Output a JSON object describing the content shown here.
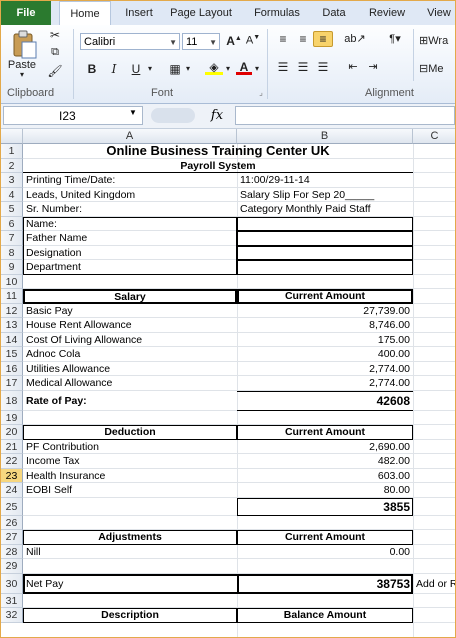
{
  "ribbon": {
    "tabs": [
      "File",
      "Home",
      "Insert",
      "Page Layout",
      "Formulas",
      "Data",
      "Review",
      "View"
    ],
    "clipboard": {
      "paste_label": "Paste",
      "group_label": "Clipboard"
    },
    "font": {
      "name": "Calibri",
      "size": "11",
      "group_label": "Font"
    },
    "alignment": {
      "group_label": "Alignment",
      "wrap_label": "Wra",
      "merge_label": "Me"
    }
  },
  "formula_bar": {
    "name_box": "I23",
    "fx": "fx",
    "value": ""
  },
  "columns": [
    "A",
    "B",
    "C"
  ],
  "rows": [
    {
      "n": "1",
      "a": "Online Business Training Center UK",
      "b": ""
    },
    {
      "n": "2",
      "a": "Payroll System",
      "b": ""
    },
    {
      "n": "3",
      "a": "Printing Time/Date:",
      "b": "11:00/29-11-14"
    },
    {
      "n": "4",
      "a": "Leads, United Kingdom",
      "b": "Salary Slip For Sep 20_____"
    },
    {
      "n": "5",
      "a": "Sr. Number:",
      "b": "Category Monthly Paid Staff"
    },
    {
      "n": "6",
      "a": "Name:",
      "b": ""
    },
    {
      "n": "7",
      "a": "Father Name",
      "b": ""
    },
    {
      "n": "8",
      "a": "Designation",
      "b": ""
    },
    {
      "n": "9",
      "a": "Department",
      "b": ""
    },
    {
      "n": "10",
      "a": "",
      "b": ""
    },
    {
      "n": "11",
      "a": "Salary",
      "b": "Current Amount"
    },
    {
      "n": "12",
      "a": "Basic Pay",
      "b": "27,739.00"
    },
    {
      "n": "13",
      "a": "House Rent Allowance",
      "b": "8,746.00"
    },
    {
      "n": "14",
      "a": "Cost Of Living Allowance",
      "b": "175.00"
    },
    {
      "n": "15",
      "a": "Adnoc Cola",
      "b": "400.00"
    },
    {
      "n": "16",
      "a": "Utilities Allowance",
      "b": "2,774.00"
    },
    {
      "n": "17",
      "a": "Medical Allowance",
      "b": "2,774.00"
    },
    {
      "n": "18",
      "a": "Rate of Pay:",
      "b": "42608"
    },
    {
      "n": "19",
      "a": "",
      "b": ""
    },
    {
      "n": "20",
      "a": "Deduction",
      "b": "Current Amount"
    },
    {
      "n": "21",
      "a": "PF Contribution",
      "b": "2,690.00"
    },
    {
      "n": "22",
      "a": "Income Tax",
      "b": "482.00"
    },
    {
      "n": "23",
      "a": "Health Insurance",
      "b": "603.00"
    },
    {
      "n": "24",
      "a": "EOBI Self",
      "b": "80.00"
    },
    {
      "n": "25",
      "a": "",
      "b": "3855"
    },
    {
      "n": "26",
      "a": "",
      "b": ""
    },
    {
      "n": "27",
      "a": "Adjustments",
      "b": "Current Amount"
    },
    {
      "n": "28",
      "a": "Nill",
      "b": "0.00"
    },
    {
      "n": "29",
      "a": "",
      "b": ""
    },
    {
      "n": "30",
      "a": "Net Pay",
      "b": "38753",
      "c": "Add or R"
    },
    {
      "n": "31",
      "a": "",
      "b": ""
    },
    {
      "n": "32",
      "a": "Description",
      "b": "Balance Amount"
    }
  ]
}
